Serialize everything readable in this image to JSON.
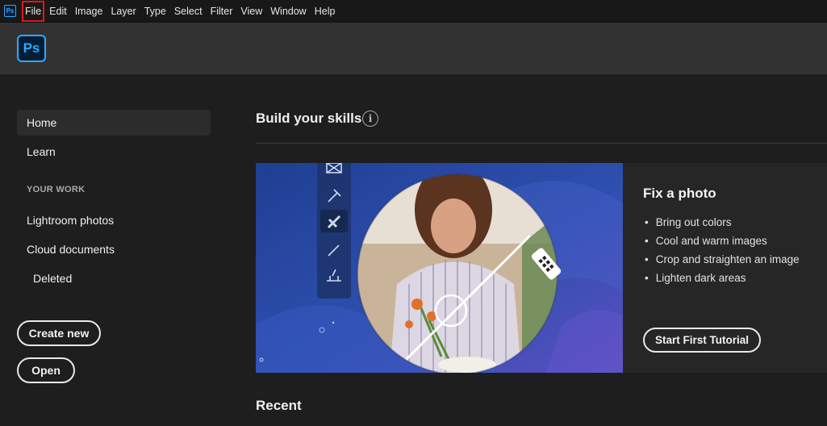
{
  "menubar": {
    "app_icon": "Ps",
    "items": [
      "File",
      "Edit",
      "Image",
      "Layer",
      "Type",
      "Select",
      "Filter",
      "View",
      "Window",
      "Help"
    ]
  },
  "header": {
    "logo": "Ps"
  },
  "sidebar": {
    "home": "Home",
    "learn": "Learn",
    "section_label": "YOUR WORK",
    "lightroom": "Lightroom photos",
    "cloud": "Cloud documents",
    "deleted": "Deleted",
    "create_new": "Create new",
    "open": "Open"
  },
  "main": {
    "skills_title": "Build your skills",
    "info_icon": "i",
    "card": {
      "title": "Fix a photo",
      "bullets": [
        "Bring out colors",
        "Cool and warm images",
        "Crop and straighten an image",
        "Lighten dark areas"
      ],
      "button": "Start First Tutorial"
    },
    "recent_title": "Recent"
  },
  "colors": {
    "accent": "#31a8ff",
    "highlight": "#e01818"
  }
}
